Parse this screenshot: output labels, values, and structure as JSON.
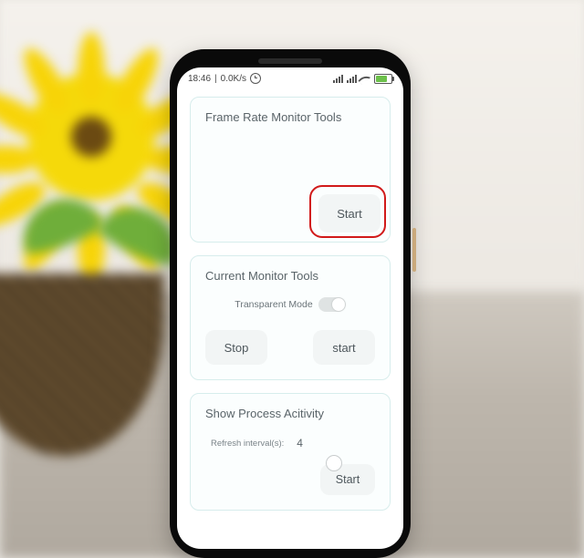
{
  "statusbar": {
    "time": "18:46",
    "net_speed": "0.0K/s"
  },
  "cards": {
    "frame_rate": {
      "title": "Frame Rate Monitor Tools",
      "start": "Start"
    },
    "current": {
      "title": "Current Monitor Tools",
      "transparent_label": "Transparent Mode",
      "stop": "Stop",
      "start": "start"
    },
    "process": {
      "title": "Show Process Acitivity",
      "refresh_label": "Refresh interval(s):",
      "refresh_value": "4",
      "start": "Start"
    }
  }
}
